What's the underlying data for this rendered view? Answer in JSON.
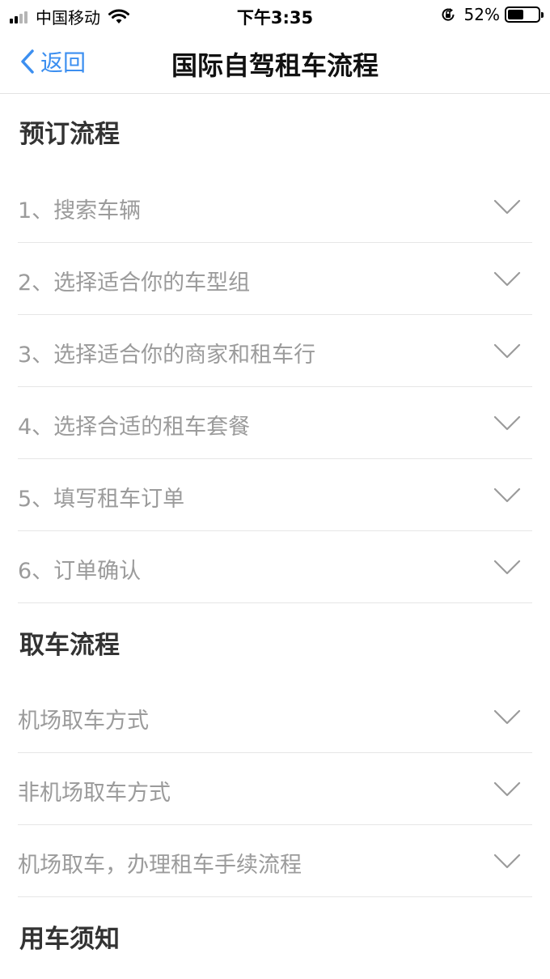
{
  "status_bar": {
    "carrier": "中国移动",
    "time": "下午3:35",
    "battery": "52%",
    "battery_level": 0.52,
    "signal_bars_active": 2,
    "signal_bars_total": 4
  },
  "nav": {
    "back_label": "返回",
    "title": "国际自驾租车流程"
  },
  "sections": [
    {
      "title": "预订流程",
      "items": [
        "1、搜索车辆",
        "2、选择适合你的车型组",
        "3、选择适合你的商家和租车行",
        "4、选择合适的租车套餐",
        "5、填写租车订单",
        "6、订单确认"
      ]
    },
    {
      "title": "取车流程",
      "items": [
        "机场取车方式",
        "非机场取车方式",
        "机场取车，办理租车手续流程"
      ]
    },
    {
      "title": "用车须知",
      "items": []
    }
  ],
  "colors": {
    "accent": "#3c8ff0",
    "item_text": "#9b9b9b",
    "header_text": "#333333",
    "divider": "#e6e6e6",
    "chevron": "#9b9b9b"
  },
  "icons": {
    "back": "chevron-left-icon",
    "expand": "chevron-down-icon",
    "wifi": "wifi-icon",
    "rotation_lock": "rotation-lock-icon",
    "battery": "battery-icon",
    "signal": "signal-icon"
  }
}
